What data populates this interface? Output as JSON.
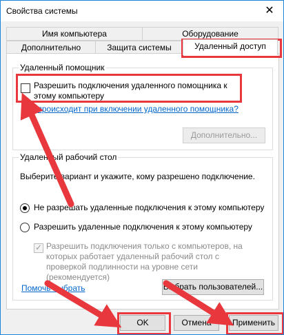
{
  "window": {
    "title": "Свойства системы",
    "close_icon": "close-icon"
  },
  "tabs": {
    "row1": [
      "Имя компьютера",
      "Оборудование"
    ],
    "row2": [
      "Дополнительно",
      "Защита системы",
      "Удаленный доступ"
    ],
    "active": "Удаленный доступ"
  },
  "remote_assistance": {
    "group_title": "Удаленный помощник",
    "checkbox_label": "Разрешить подключения удаленного помощника к этому компьютеру",
    "checkbox_checked": false,
    "link": "Что происходит при включении удаленного помощника?",
    "advanced_button": "Дополнительно..."
  },
  "remote_desktop": {
    "group_title": "Удаленный рабочий стол",
    "instruction": "Выберите вариант и укажите, кому разрешено подключение.",
    "option_deny": "Не разрешать удаленные подключения к этому компьютеру",
    "option_allow": "Разрешить удаленные подключения к этому компьютеру",
    "selected": "deny",
    "nla_label": "Разрешить подключения только с компьютеров, на которых работает удаленный рабочий стол с проверкой подлинности на уровне сети (рекомендуется)",
    "nla_checked": true,
    "help_link": "Помочь выбрать",
    "select_users_button": "Выбрать пользователей..."
  },
  "footer": {
    "ok": "OK",
    "cancel": "Отмена",
    "apply": "Применить"
  },
  "annotation_color": "#e8383d"
}
